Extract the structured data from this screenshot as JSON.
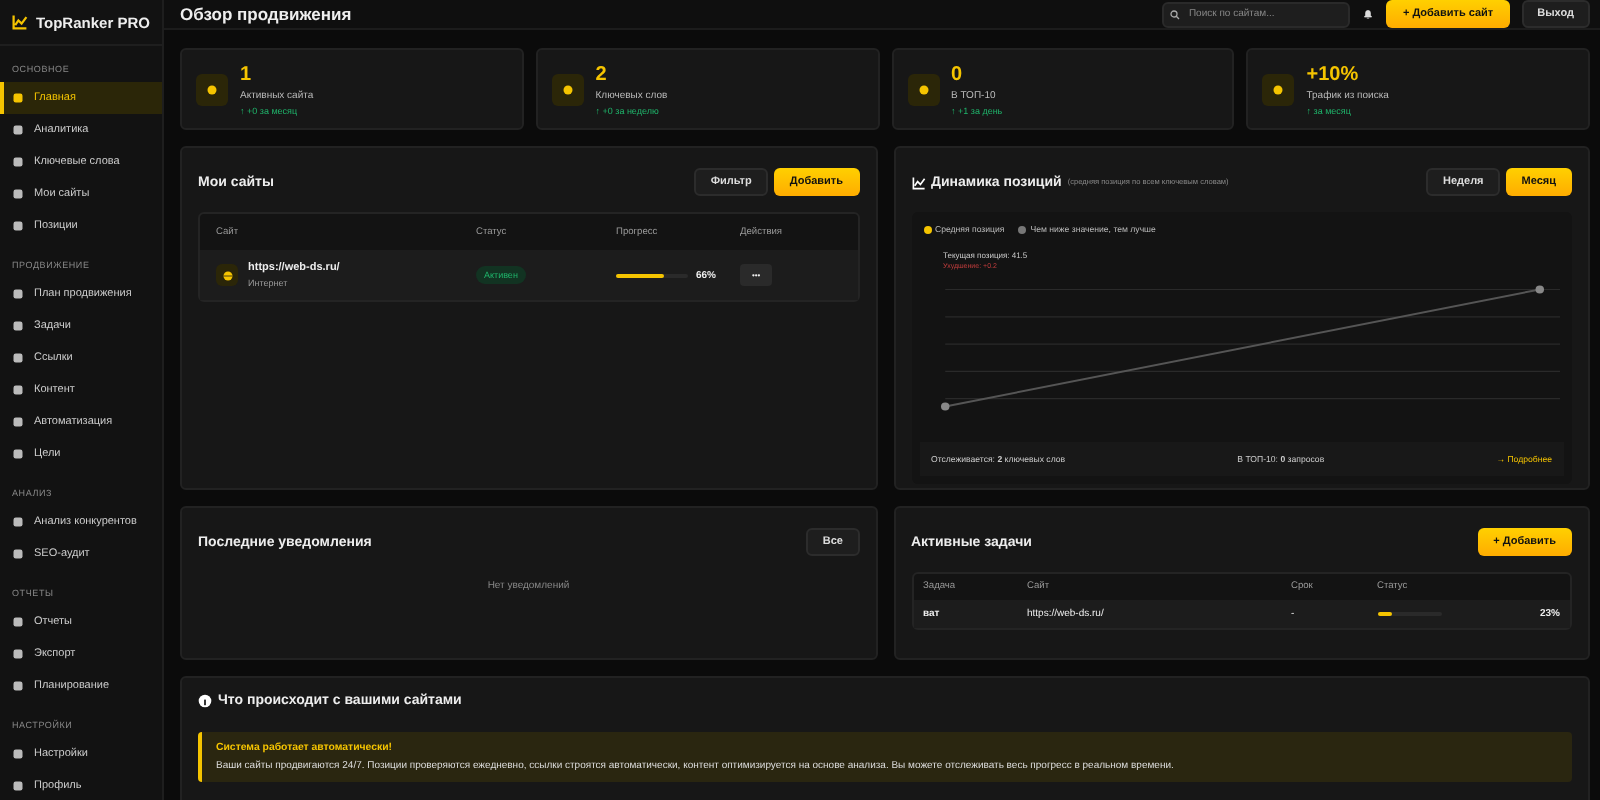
{
  "brand": "TopRanker PRO",
  "sidebar": [
    {
      "title": "ОСНОВНОЕ",
      "items": [
        {
          "label": "Главная",
          "selected": true
        },
        {
          "label": "Аналитика",
          "selected": false
        },
        {
          "label": "Ключевые слова",
          "selected": false
        },
        {
          "label": "Мои сайты",
          "selected": false
        },
        {
          "label": "Позиции",
          "selected": false
        }
      ]
    },
    {
      "title": "ПРОДВИЖЕНИЕ",
      "items": [
        {
          "label": "План продвижения",
          "selected": false
        },
        {
          "label": "Задачи",
          "selected": false
        },
        {
          "label": "Ссылки",
          "selected": false
        },
        {
          "label": "Контент",
          "selected": false
        },
        {
          "label": "Автоматизация",
          "selected": false
        },
        {
          "label": "Цели",
          "selected": false
        }
      ]
    },
    {
      "title": "АНАЛИЗ",
      "items": [
        {
          "label": "Анализ конкурентов",
          "selected": false
        },
        {
          "label": "SEO-аудит",
          "selected": false
        }
      ]
    },
    {
      "title": "ОТЧЕТЫ",
      "items": [
        {
          "label": "Отчеты",
          "selected": false
        },
        {
          "label": "Экспорт",
          "selected": false
        },
        {
          "label": "Планирование",
          "selected": false
        }
      ]
    },
    {
      "title": "НАСТРОЙКИ",
      "items": [
        {
          "label": "Настройки",
          "selected": false
        },
        {
          "label": "Профиль",
          "selected": false
        }
      ]
    }
  ],
  "header": {
    "title": "Обзор продвижения",
    "search_placeholder": "Поиск по сайтам...",
    "add_button": "+ Добавить сайт",
    "logout_button": "Выход"
  },
  "stats": [
    {
      "value": "1",
      "label": "Активных сайта",
      "delta": "↑ +0 за месяц"
    },
    {
      "value": "2",
      "label": "Ключевых слов",
      "delta": "↑ +0 за неделю"
    },
    {
      "value": "0",
      "label": "В ТОП-10",
      "delta": "↑ +1 за день"
    },
    {
      "value": "+10%",
      "label": "Трафик из поиска",
      "delta": "↑ за месяц"
    }
  ],
  "sites": {
    "title": "Мои сайты",
    "filter_button": "Фильтр",
    "add_button": "Добавить",
    "columns": [
      "Сайт",
      "Статус",
      "Прогресс",
      "Действия"
    ],
    "rows": [
      {
        "url": "https://web-ds.ru/",
        "category": "Интернет",
        "status": "Активен",
        "level": 0.66,
        "progress": "66%",
        "action": "•••"
      }
    ]
  },
  "positions": {
    "title": "Динамика позиций",
    "subtitle": "(средняя позиция по всем ключевым словам)",
    "periods": [
      {
        "label": "Неделя",
        "selected": false
      },
      {
        "label": "Месяц",
        "selected": true
      }
    ],
    "legend": [
      "Средняя позиция",
      "Чем ниже значение, тем лучше"
    ],
    "tooltip_title": "Текущая позиция: 41.5",
    "tooltip_delta": "Ухудшение: +0.2",
    "footer_tracked": "Отслеживается: **2** ключевых слов",
    "footer_top": "В ТОП-10: **0** запросов",
    "footer_link": "→ Подробнее"
  },
  "notifications": {
    "title": "Последние уведомления",
    "all_button": "Все",
    "empty": "Нет уведомлений"
  },
  "tasks": {
    "title": "Активные задачи",
    "add_button": "+ Добавить",
    "columns": [
      "Задача",
      "Сайт",
      "Срок",
      "Статус"
    ],
    "rows": [
      {
        "task": "ват",
        "site": "https://web-ds.ru/",
        "due": "-",
        "level": 0.23,
        "progress": "23%"
      }
    ]
  },
  "activity": {
    "title": "Что происходит с вашими сайтами",
    "alert_title": "Система работает автоматически!",
    "alert_text": "Ваши сайты продвигаются 24/7. Позиции проверяются ежедневно, ссылки строятся автоматически, контент оптимизируется на основе анализа. Вы можете отслеживать весь прогресс в реальном времени."
  }
}
